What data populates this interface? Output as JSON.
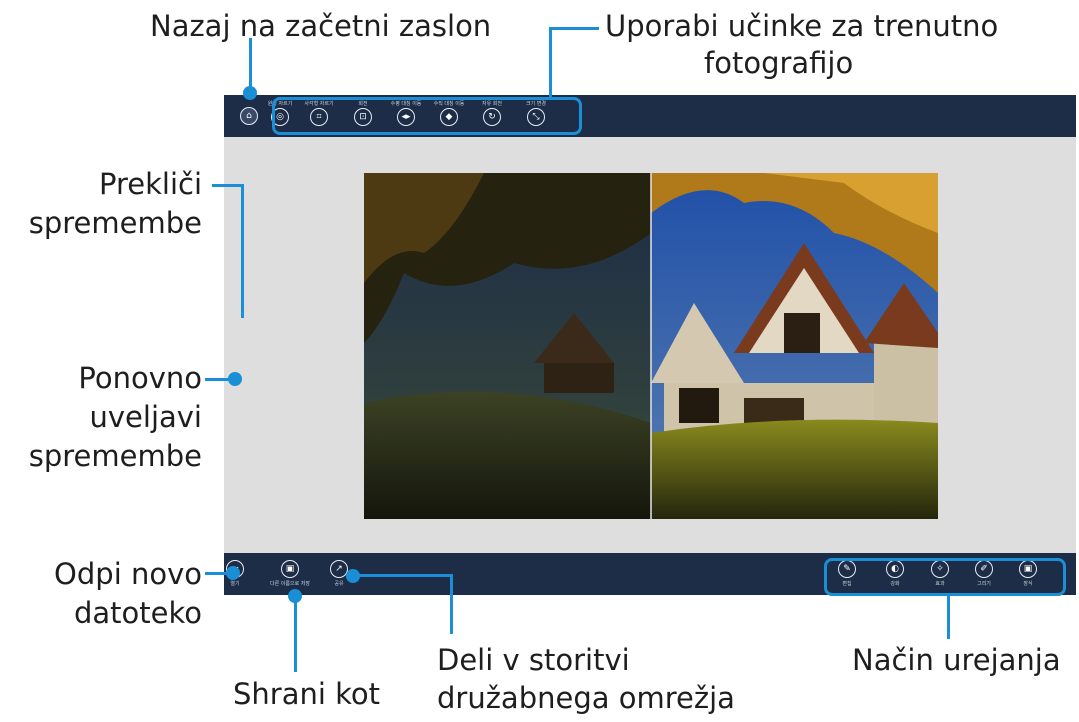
{
  "callouts": {
    "home": "Nazaj na začetni zaslon",
    "effects_line1": "Uporabi učinke za trenutno",
    "effects_line2": "fotografijo",
    "undo_line1": "Prekliči",
    "undo_line2": "spremembe",
    "redo_line1": "Ponovno",
    "redo_line2": "uveljavi",
    "redo_line3": "spremembe",
    "open_line1": "Odpi novo",
    "open_line2": "datoteko",
    "save_as": "Shrani kot",
    "share_line1": "Deli v storitvi",
    "share_line2": "družabnega omrežja",
    "edit_mode": "Način urejanja"
  },
  "toolbar": {
    "home_icon": "home-icon",
    "items": [
      {
        "label": "원형 자르기",
        "icon": "crop-circle-icon",
        "glyph": "◎"
      },
      {
        "label": "사각형 자르기",
        "icon": "crop-rect-icon",
        "glyph": "⌗"
      },
      {
        "label": "회전",
        "icon": "rotate-icon",
        "glyph": "⊡"
      },
      {
        "label": "수평 대칭 이동",
        "icon": "flip-horizontal-icon",
        "glyph": "◂▸"
      },
      {
        "label": "수직 대칭 이동",
        "icon": "flip-vertical-icon",
        "glyph": "◆"
      },
      {
        "label": "자유 회전",
        "icon": "free-rotate-icon",
        "glyph": "↻"
      },
      {
        "label": "크기 변경",
        "icon": "resize-icon",
        "glyph": "⤡"
      }
    ]
  },
  "bottombar": {
    "left": [
      {
        "label": "열기",
        "icon": "open-folder-icon",
        "glyph": "▰"
      },
      {
        "label": "다른 이름으로 저장",
        "icon": "save-icon",
        "glyph": "▣"
      },
      {
        "label": "공유",
        "icon": "share-icon",
        "glyph": "↗"
      }
    ],
    "right": [
      {
        "label": "편집",
        "icon": "edit-icon",
        "glyph": "✎"
      },
      {
        "label": "강화",
        "icon": "enhance-icon",
        "glyph": "◐"
      },
      {
        "label": "효과",
        "icon": "effect-wand-icon",
        "glyph": "✧"
      },
      {
        "label": "그리기",
        "icon": "draw-pen-icon",
        "glyph": "✐"
      },
      {
        "label": "장식",
        "icon": "decorate-icon",
        "glyph": "▣"
      }
    ]
  },
  "colors": {
    "accent": "#1a8fd6",
    "bar": "#1d2d47",
    "canvas": "#dedede"
  }
}
